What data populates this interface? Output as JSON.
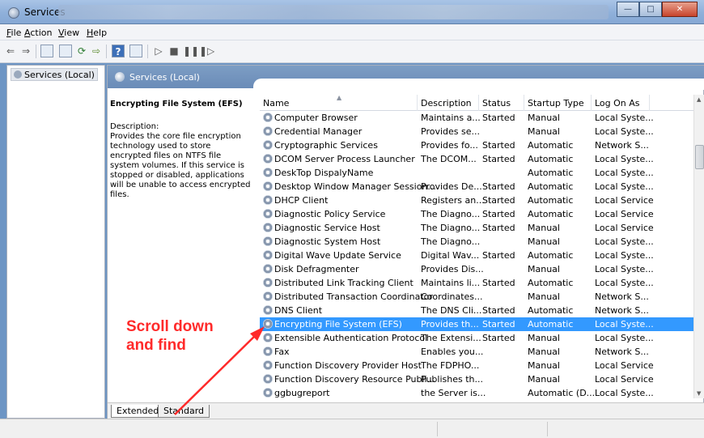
{
  "window": {
    "title": "Services"
  },
  "menu": [
    "File",
    "Action",
    "View",
    "Help"
  ],
  "tree": {
    "item": "Services (Local)"
  },
  "pane": {
    "header": "Services (Local)",
    "desc": {
      "name": "Encrypting File System (EFS)",
      "label": "Description:",
      "text": "Provides the core file encryption technology used to store encrypted files on NTFS file system volumes. If this service is stopped or disabled, applications will be unable to access encrypted files."
    }
  },
  "columns": [
    "Name",
    "Description",
    "Status",
    "Startup Type",
    "Log On As"
  ],
  "rows": [
    {
      "name": "Computer Browser",
      "desc": "Maintains a...",
      "status": "Started",
      "startup": "Manual",
      "logon": "Local Syste..."
    },
    {
      "name": "Credential Manager",
      "desc": "Provides se...",
      "status": "",
      "startup": "Manual",
      "logon": "Local Syste..."
    },
    {
      "name": "Cryptographic Services",
      "desc": "Provides fo...",
      "status": "Started",
      "startup": "Automatic",
      "logon": "Network S..."
    },
    {
      "name": "DCOM Server Process Launcher",
      "desc": "The DCOM...",
      "status": "Started",
      "startup": "Automatic",
      "logon": "Local Syste..."
    },
    {
      "name": "DeskTop DispalyName",
      "desc": "",
      "status": "",
      "startup": "Automatic",
      "logon": "Local Syste..."
    },
    {
      "name": "Desktop Window Manager Session...",
      "desc": "Provides De...",
      "status": "Started",
      "startup": "Automatic",
      "logon": "Local Syste..."
    },
    {
      "name": "DHCP Client",
      "desc": "Registers an...",
      "status": "Started",
      "startup": "Automatic",
      "logon": "Local Service"
    },
    {
      "name": "Diagnostic Policy Service",
      "desc": "The Diagno...",
      "status": "Started",
      "startup": "Automatic",
      "logon": "Local Service"
    },
    {
      "name": "Diagnostic Service Host",
      "desc": "The Diagno...",
      "status": "Started",
      "startup": "Manual",
      "logon": "Local Service"
    },
    {
      "name": "Diagnostic System Host",
      "desc": "The Diagno...",
      "status": "",
      "startup": "Manual",
      "logon": "Local Syste..."
    },
    {
      "name": "Digital Wave Update Service",
      "desc": "Digital Wav...",
      "status": "Started",
      "startup": "Automatic",
      "logon": "Local Syste..."
    },
    {
      "name": "Disk Defragmenter",
      "desc": "Provides Dis...",
      "status": "",
      "startup": "Manual",
      "logon": "Local Syste..."
    },
    {
      "name": "Distributed Link Tracking Client",
      "desc": "Maintains li...",
      "status": "Started",
      "startup": "Automatic",
      "logon": "Local Syste..."
    },
    {
      "name": "Distributed Transaction Coordinator",
      "desc": "Coordinates...",
      "status": "",
      "startup": "Manual",
      "logon": "Network S..."
    },
    {
      "name": "DNS Client",
      "desc": "The DNS Cli...",
      "status": "Started",
      "startup": "Automatic",
      "logon": "Network S..."
    },
    {
      "name": "Encrypting File System (EFS)",
      "desc": "Provides th...",
      "status": "Started",
      "startup": "Automatic",
      "logon": "Local Syste...",
      "selected": true
    },
    {
      "name": "Extensible Authentication Protocol",
      "desc": "The Extensi...",
      "status": "Started",
      "startup": "Manual",
      "logon": "Local Syste..."
    },
    {
      "name": "Fax",
      "desc": "Enables you...",
      "status": "",
      "startup": "Manual",
      "logon": "Network S..."
    },
    {
      "name": "Function Discovery Provider Host",
      "desc": "The FDPHO...",
      "status": "",
      "startup": "Manual",
      "logon": "Local Service"
    },
    {
      "name": "Function Discovery Resource Publi...",
      "desc": "Publishes th...",
      "status": "",
      "startup": "Manual",
      "logon": "Local Service"
    },
    {
      "name": "ggbugreport",
      "desc": "the Server is...",
      "status": "",
      "startup": "Automatic (D...",
      "logon": "Local Syste..."
    }
  ],
  "tabs": [
    "Extended",
    "Standard"
  ],
  "annotation": {
    "line1": "Scroll down",
    "line2": "and find",
    "color": "#ff2a2a"
  }
}
